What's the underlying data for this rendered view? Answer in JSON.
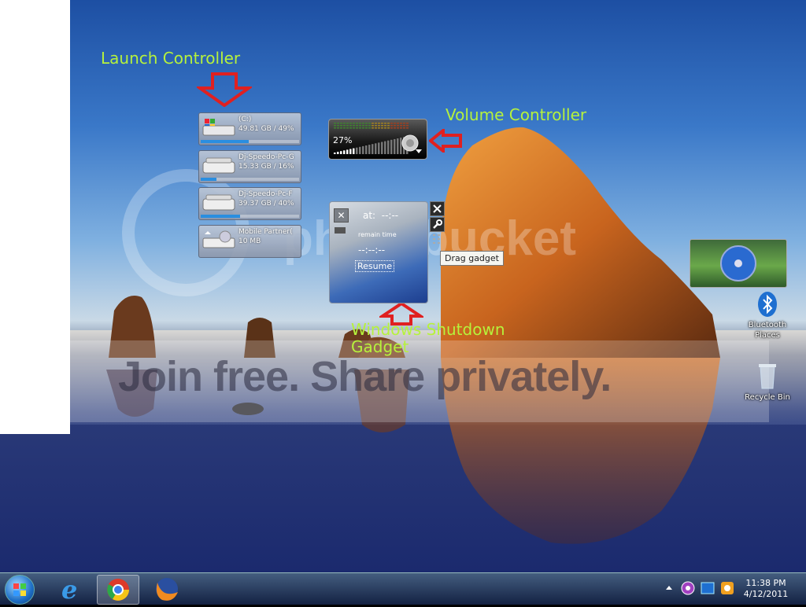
{
  "annotations": {
    "launch_controller": "Launch Controller",
    "volume_controller": "Volume Controller",
    "shutdown_line1": "Windows Shutdown",
    "shutdown_line2": "Gadget"
  },
  "drives": [
    {
      "name": "(C:)",
      "info": "49.81 GB / 49%",
      "percent": 49
    },
    {
      "name": "Dj-Speedo-Pc-G",
      "info": "15.33 GB / 16%",
      "percent": 16
    },
    {
      "name": "Dj-Speedo-Pc-F",
      "info": "39.37 GB / 40%",
      "percent": 40
    },
    {
      "name": "Mobile Partner(",
      "info": "10 MB",
      "percent": 0
    }
  ],
  "volume": {
    "percent_label": "27%",
    "level": 27
  },
  "shutdown": {
    "at_label": "at:",
    "at_time": "--:--",
    "remain_label": "remain time",
    "remain_value": "--:--:--",
    "resume_label": "Resume"
  },
  "tooltip": "Drag gadget",
  "watermark": {
    "logo": "photobucket",
    "slogan": "Join free. Share privately."
  },
  "desktop_icons": {
    "bluetooth": "Bluetooth Places",
    "recycle": "Recycle Bin"
  },
  "clock": {
    "time": "11:38 PM",
    "date": "4/12/2011"
  },
  "colors": {
    "annotation": "#b6f23c",
    "arrow": "#e02020"
  }
}
